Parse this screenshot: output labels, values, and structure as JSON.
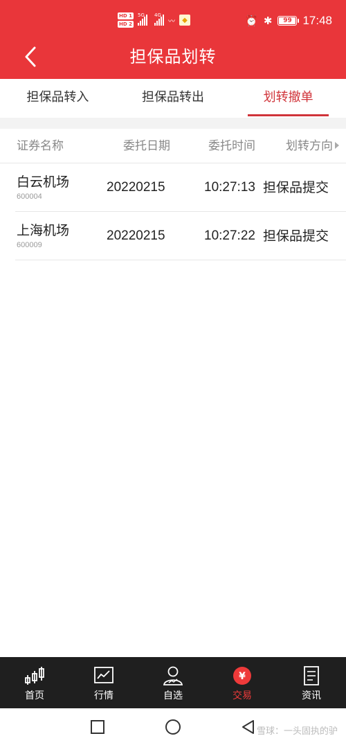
{
  "status_bar": {
    "hd1": "HD 1",
    "hd2": "HD 2",
    "net1": "5G",
    "net2": "4G",
    "battery": "99",
    "time": "17:48"
  },
  "header": {
    "title": "担保品划转"
  },
  "tabs": [
    {
      "label": "担保品转入",
      "active": false
    },
    {
      "label": "担保品转出",
      "active": false
    },
    {
      "label": "划转撤单",
      "active": true
    }
  ],
  "table": {
    "columns": [
      "证券名称",
      "委托日期",
      "委托时间",
      "划转方向"
    ],
    "rows": [
      {
        "name": "白云机场",
        "code": "600004",
        "date": "20220215",
        "time": "10:27:13",
        "direction": "担保品提交"
      },
      {
        "name": "上海机场",
        "code": "600009",
        "date": "20220215",
        "time": "10:27:22",
        "direction": "担保品提交"
      }
    ]
  },
  "bottom_nav": [
    {
      "label": "首页",
      "icon": "candlestick-icon"
    },
    {
      "label": "行情",
      "icon": "line-chart-icon"
    },
    {
      "label": "自选",
      "icon": "user-chart-icon"
    },
    {
      "label": "交易",
      "icon": "yen-circle-icon",
      "active": true
    },
    {
      "label": "资讯",
      "icon": "document-icon"
    }
  ],
  "watermark": "雪球：一头固执的驴",
  "colors": {
    "brand_red": "#e9363a",
    "active_tab": "#d0343a",
    "nav_bg": "#1f1f1f",
    "nav_active": "#ee3a3a"
  }
}
